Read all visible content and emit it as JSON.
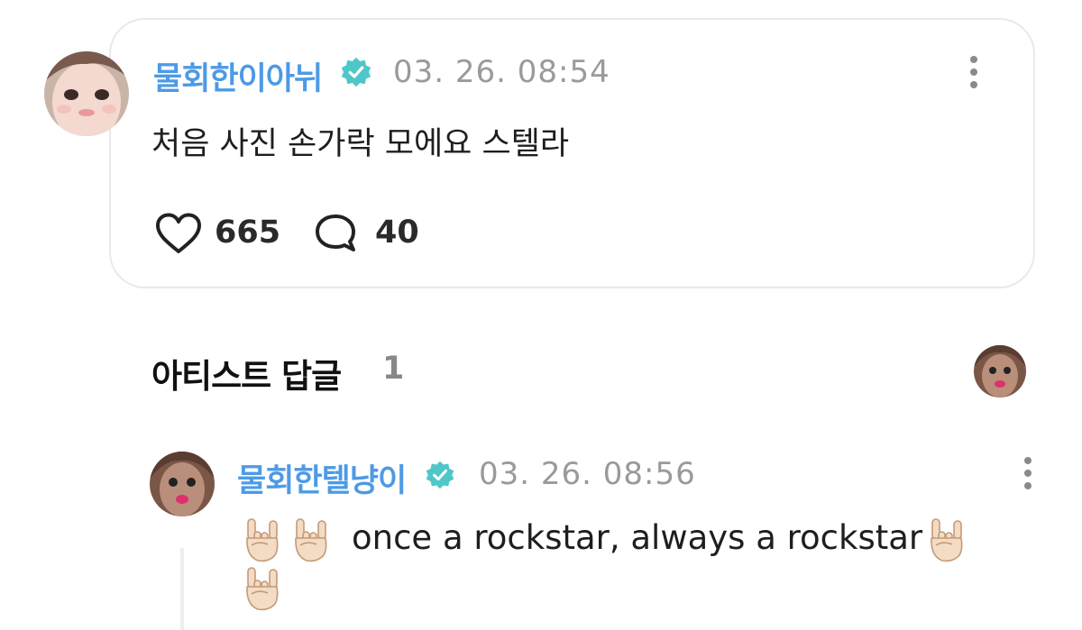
{
  "post": {
    "author": "물회한이아뉘",
    "timestamp": "03. 26. 08:54",
    "text": "처음 사진 손가락 모에요 스텔라",
    "likes": "665",
    "comments": "40",
    "avatar_icon": "user-avatar-photo",
    "verified_icon": "verified-badge-icon",
    "more_icon": "kebab-menu-icon",
    "like_icon": "heart-outline-icon",
    "comment_icon": "speech-bubble-outline-icon"
  },
  "artist_replies": {
    "title": "아티스트 답글",
    "count": "1",
    "artist_avatar_icon": "artist-avatar-photo"
  },
  "reply": {
    "author": "물회한텔냥이",
    "timestamp": "03. 26. 08:56",
    "text": "once a rockstar, always a rockstar",
    "emoji": "🤘",
    "emoji_icon": "rock-on-hand-emoji",
    "more_icon": "kebab-menu-icon"
  },
  "colors": {
    "name_blue": "#4d9ae6",
    "verified_teal": "#4fc7c9",
    "timestamp_gray": "#9a9a9a",
    "card_border": "#e8e8ee",
    "count_gray": "#888888"
  }
}
